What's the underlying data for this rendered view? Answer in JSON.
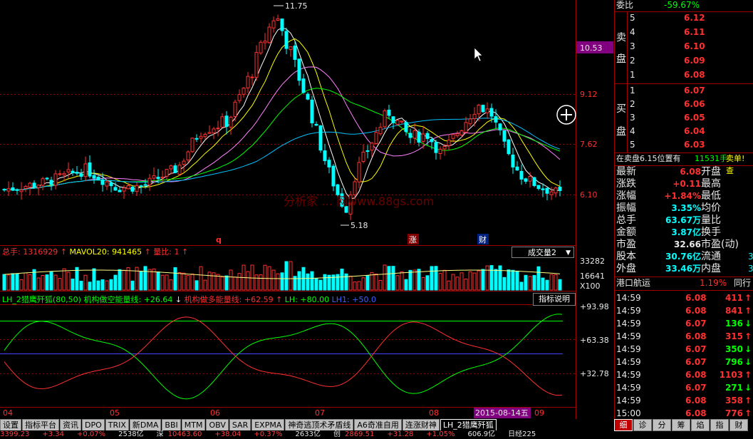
{
  "price_chart": {
    "axis_labels": [
      "10.53",
      "9.12",
      "7.62",
      "6.10"
    ],
    "high_marker": "11.75",
    "low_marker": "5.18",
    "watermark": "分析家 … 网www.88gs.com",
    "event_markers": [
      "q",
      "涨",
      "财"
    ]
  },
  "volume": {
    "header": {
      "total_label": "总手:",
      "total_value": "1316929",
      "mavol_label": "MAVOL20:",
      "mavol_value": "941465",
      "ratio_label": "量比:",
      "ratio_value": "1"
    },
    "dropdown": "成交量2",
    "axis_labels": [
      "33282",
      "16641",
      "X100"
    ]
  },
  "indicator": {
    "header": {
      "name": "LH_2猎鹰歼狐(80,50)",
      "short_label": "机构做空能量线:",
      "short_value": "+26.64",
      "long_label": "机构做多能量线:",
      "long_value": "+62.59",
      "lh_label": "LH:",
      "lh_value": "+80.00",
      "lh1_label": "LH1:",
      "lh1_value": "+50.0"
    },
    "help_button": "指标说明",
    "axis_labels": [
      "+93.98",
      "+63.38",
      "+32.78"
    ]
  },
  "x_axis": {
    "months": [
      "04",
      "05",
      "06",
      "07",
      "08",
      "09"
    ],
    "cursor_date": "2015-08-14五"
  },
  "tabs": [
    "设置",
    "指标平台",
    "资讯",
    "DPO",
    "TRIX",
    "新DMA",
    "BBI",
    "MTM",
    "OBV",
    "SAR",
    "EXPMA",
    "神奇逃顶术矛盾线",
    "A6奇准自用",
    "连涨财神",
    "LH_2猎鹰歼狐"
  ],
  "active_tab": "LH_2猎鹰歼狐",
  "order_book": {
    "ratio_label": "委比",
    "ratio_value": "-59.67%",
    "sell_label": [
      "卖",
      "盘"
    ],
    "buy_label": [
      "买",
      "盘"
    ],
    "asks": [
      {
        "level": "5",
        "price": "6.12"
      },
      {
        "level": "4",
        "price": "6.11"
      },
      {
        "level": "3",
        "price": "6.10"
      },
      {
        "level": "2",
        "price": "6.09"
      },
      {
        "level": "1",
        "price": "6.08"
      }
    ],
    "bids": [
      {
        "level": "1",
        "price": "6.07"
      },
      {
        "level": "2",
        "price": "6.06"
      },
      {
        "level": "3",
        "price": "6.05"
      },
      {
        "level": "4",
        "price": "6.04"
      },
      {
        "level": "5",
        "price": "6.03"
      }
    ],
    "notice_text": "在卖盘6.15位置有",
    "notice_volume": "11531手",
    "notice_tail": "卖单! 查"
  },
  "quote": {
    "rows": [
      {
        "l": "最新",
        "v": "6.08",
        "r": "开盘"
      },
      {
        "l": "涨跌",
        "v": "+0.11",
        "r": "最高"
      },
      {
        "l": "涨幅",
        "v": "+1.84%",
        "r": "最低"
      },
      {
        "l": "振幅",
        "v": "3.35%",
        "r": "均价"
      },
      {
        "l": "总手",
        "v": "63.67万",
        "r": "量比"
      },
      {
        "l": "金额",
        "v": "3.87亿",
        "r": "换手"
      },
      {
        "l": "市盈",
        "v": "32.66",
        "r": "市盈(动)"
      },
      {
        "l": "股本",
        "v": "30.76亿",
        "r": "流通"
      },
      {
        "l": "外盘",
        "v": "33.46万",
        "r": "内盘"
      }
    ],
    "right_partial": [
      "3",
      "3"
    ]
  },
  "stock": {
    "name": "港口航运",
    "change": "1.19%",
    "side_label": "同行"
  },
  "ticks": [
    {
      "time": "14:59",
      "price": "6.08",
      "vol": "411",
      "dir": "up"
    },
    {
      "time": "14:59",
      "price": "6.08",
      "vol": "841",
      "dir": "up"
    },
    {
      "time": "14:59",
      "price": "6.07",
      "vol": "136",
      "dir": "down"
    },
    {
      "time": "14:59",
      "price": "6.08",
      "vol": "315",
      "dir": "up"
    },
    {
      "time": "14:59",
      "price": "6.07",
      "vol": "350",
      "dir": "down"
    },
    {
      "time": "14:59",
      "price": "6.07",
      "vol": "796",
      "dir": "down"
    },
    {
      "time": "14:59",
      "price": "6.08",
      "vol": "1103",
      "dir": "up"
    },
    {
      "time": "14:59",
      "price": "6.07",
      "vol": "271",
      "dir": "down"
    },
    {
      "time": "14:59",
      "price": "6.08",
      "vol": "358",
      "dir": "up"
    },
    {
      "time": "15:00",
      "price": "6.08",
      "vol": "776",
      "dir": "up"
    }
  ],
  "bottom_tabs": [
    "细",
    "诊",
    "分",
    "筹",
    "焰",
    "指",
    "财"
  ],
  "status_bar": [
    "3399.23",
    "+3.34",
    "+0.07%",
    "2538亿",
    "深",
    "10463.60",
    "+38.04",
    "+0.37%",
    "2633亿",
    "创",
    "2869.51",
    "+31.28",
    "+1.05%",
    "606.9亿",
    "日经225"
  ],
  "colors": {
    "up": "#ff3030",
    "down": "#00ffff",
    "grid": "#a00000",
    "ma5": "#ffffff",
    "ma10": "#ffff00",
    "ma20": "#ff80ff",
    "ma30": "#00ff00",
    "ma60": "#00c0ff"
  }
}
